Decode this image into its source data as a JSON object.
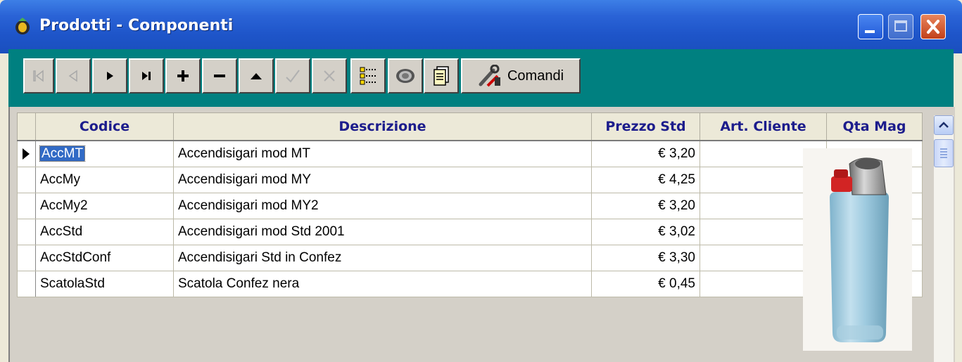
{
  "window": {
    "title": "Prodotti - Componenti",
    "controls": [
      "minimize",
      "maximize",
      "close"
    ]
  },
  "toolbar": {
    "buttons": [
      {
        "icon": "first-record-icon",
        "enabled": false
      },
      {
        "icon": "previous-record-icon",
        "enabled": false
      },
      {
        "icon": "next-record-icon",
        "enabled": true
      },
      {
        "icon": "last-record-icon",
        "enabled": true
      },
      {
        "icon": "add-record-icon",
        "enabled": true
      },
      {
        "icon": "delete-record-icon",
        "enabled": true
      },
      {
        "icon": "edit-record-icon",
        "enabled": true
      },
      {
        "icon": "confirm-icon",
        "enabled": false
      },
      {
        "icon": "cancel-icon",
        "enabled": false
      },
      {
        "icon": "tree-view-icon",
        "enabled": true
      },
      {
        "icon": "filter-icon",
        "enabled": true
      },
      {
        "icon": "report-icon",
        "enabled": true
      }
    ],
    "comandi_label": "Comandi"
  },
  "grid": {
    "columns": [
      "Codice",
      "Descrizione",
      "Prezzo Std",
      "Art. Cliente",
      "Qta Mag"
    ],
    "rows": [
      {
        "codice": "AccMT",
        "descrizione": "Accendisigari mod MT",
        "prezzo": "€ 3,20",
        "art_cliente": "",
        "qta_mag": ""
      },
      {
        "codice": "AccMy",
        "descrizione": "Accendisigari mod MY",
        "prezzo": "€ 4,25",
        "art_cliente": "",
        "qta_mag": ""
      },
      {
        "codice": "AccMy2",
        "descrizione": "Accendisigari mod MY2",
        "prezzo": "€ 3,20",
        "art_cliente": "",
        "qta_mag": ""
      },
      {
        "codice": "AccStd",
        "descrizione": "Accendisigari mod Std 2001",
        "prezzo": "€ 3,02",
        "art_cliente": "",
        "qta_mag": ""
      },
      {
        "codice": "AccStdConf",
        "descrizione": "Accendisigari Std in Confez",
        "prezzo": "€ 3,30",
        "art_cliente": "",
        "qta_mag": ""
      },
      {
        "codice": "ScatolaStd",
        "descrizione": "Scatola Confez nera",
        "prezzo": "€ 0,45",
        "art_cliente": "",
        "qta_mag": ""
      }
    ],
    "selected_row": 0
  },
  "colors": {
    "titlebar": "#1e55c9",
    "toolbar_bg": "#008080",
    "header_text": "#1c1c8c",
    "selection": "#316ac5"
  }
}
